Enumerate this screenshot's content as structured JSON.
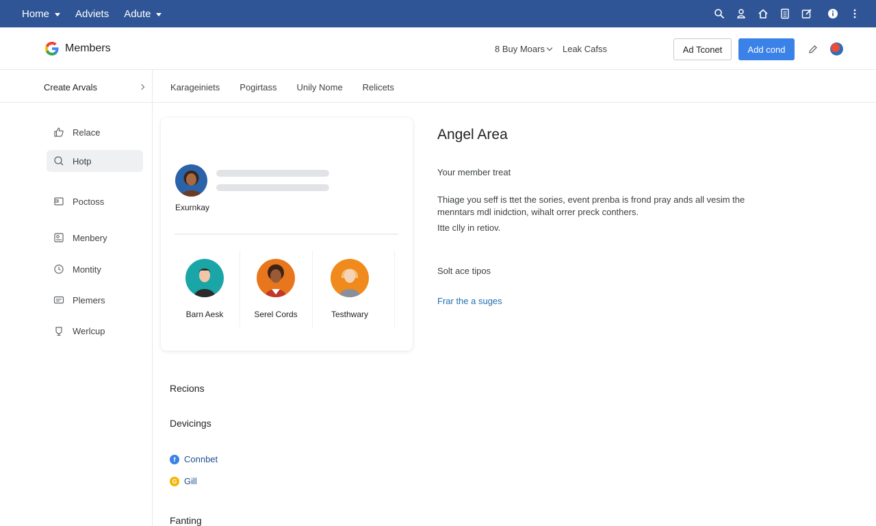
{
  "topnav": {
    "items": [
      {
        "label": "Home",
        "has_menu": true
      },
      {
        "label": "Adviets",
        "has_menu": false
      },
      {
        "label": "Adute",
        "has_menu": true
      }
    ],
    "icons": [
      "search-icon",
      "user-icon",
      "home-icon",
      "document-icon",
      "edit-icon",
      "info-icon",
      "more-vert-icon"
    ],
    "background": "#2f5597"
  },
  "header": {
    "title": "Members",
    "links": [
      {
        "label": "8 Buy Moars",
        "has_menu": true
      },
      {
        "label": "Leak Cafss",
        "has_menu": false
      }
    ],
    "outline_button": "Ad Tconet",
    "primary_button": "Add cond",
    "accent": "#3b82e8"
  },
  "subheader": {
    "create_label": "Create Arvals",
    "tabs": [
      "Karageiniets",
      "Pogirtass",
      "Unily Nome",
      "Relicets"
    ]
  },
  "sidebar": {
    "items": [
      {
        "label": "Relace",
        "icon": "thumbs-up-icon",
        "active": false
      },
      {
        "label": "Hotp",
        "icon": "search-icon",
        "active": true
      },
      {
        "label": "Poctoss",
        "icon": "box-icon",
        "active": false
      },
      {
        "label": "Menbery",
        "icon": "member-card-icon",
        "active": false
      },
      {
        "label": "Montity",
        "icon": "clock-icon",
        "active": false
      },
      {
        "label": "Plemers",
        "icon": "id-card-icon",
        "active": false
      },
      {
        "label": "Werlcup",
        "icon": "cup-icon",
        "active": false
      }
    ]
  },
  "card": {
    "name": "Exurnkay",
    "people": [
      {
        "name": "Barn Aesk",
        "color": "#1aa6a6"
      },
      {
        "name": "Serel Cords",
        "color": "#e8761c"
      },
      {
        "name": "Testhwary",
        "color": "#f08a1c"
      }
    ]
  },
  "main": {
    "title": "Angel Area",
    "subtitle": "Your member treat",
    "paragraph": "Thiage you seff is ttet the sories, event prenba is frond pray ands all vesim the menntars mdl inidction, wihalt orrer preck conthers.",
    "paragraph2": "Itte clly in retiov.",
    "section": "Solt ace tipos",
    "link": "Frar the a suges"
  },
  "lower": {
    "recents": "Recions",
    "devices_heading": "Devicings",
    "devices": [
      {
        "label": "Connbet",
        "badge": "f",
        "color": "#3b82e8"
      },
      {
        "label": "Gill",
        "badge": "G",
        "color": "#f4b400"
      }
    ],
    "footer_heading": "Fanting"
  }
}
